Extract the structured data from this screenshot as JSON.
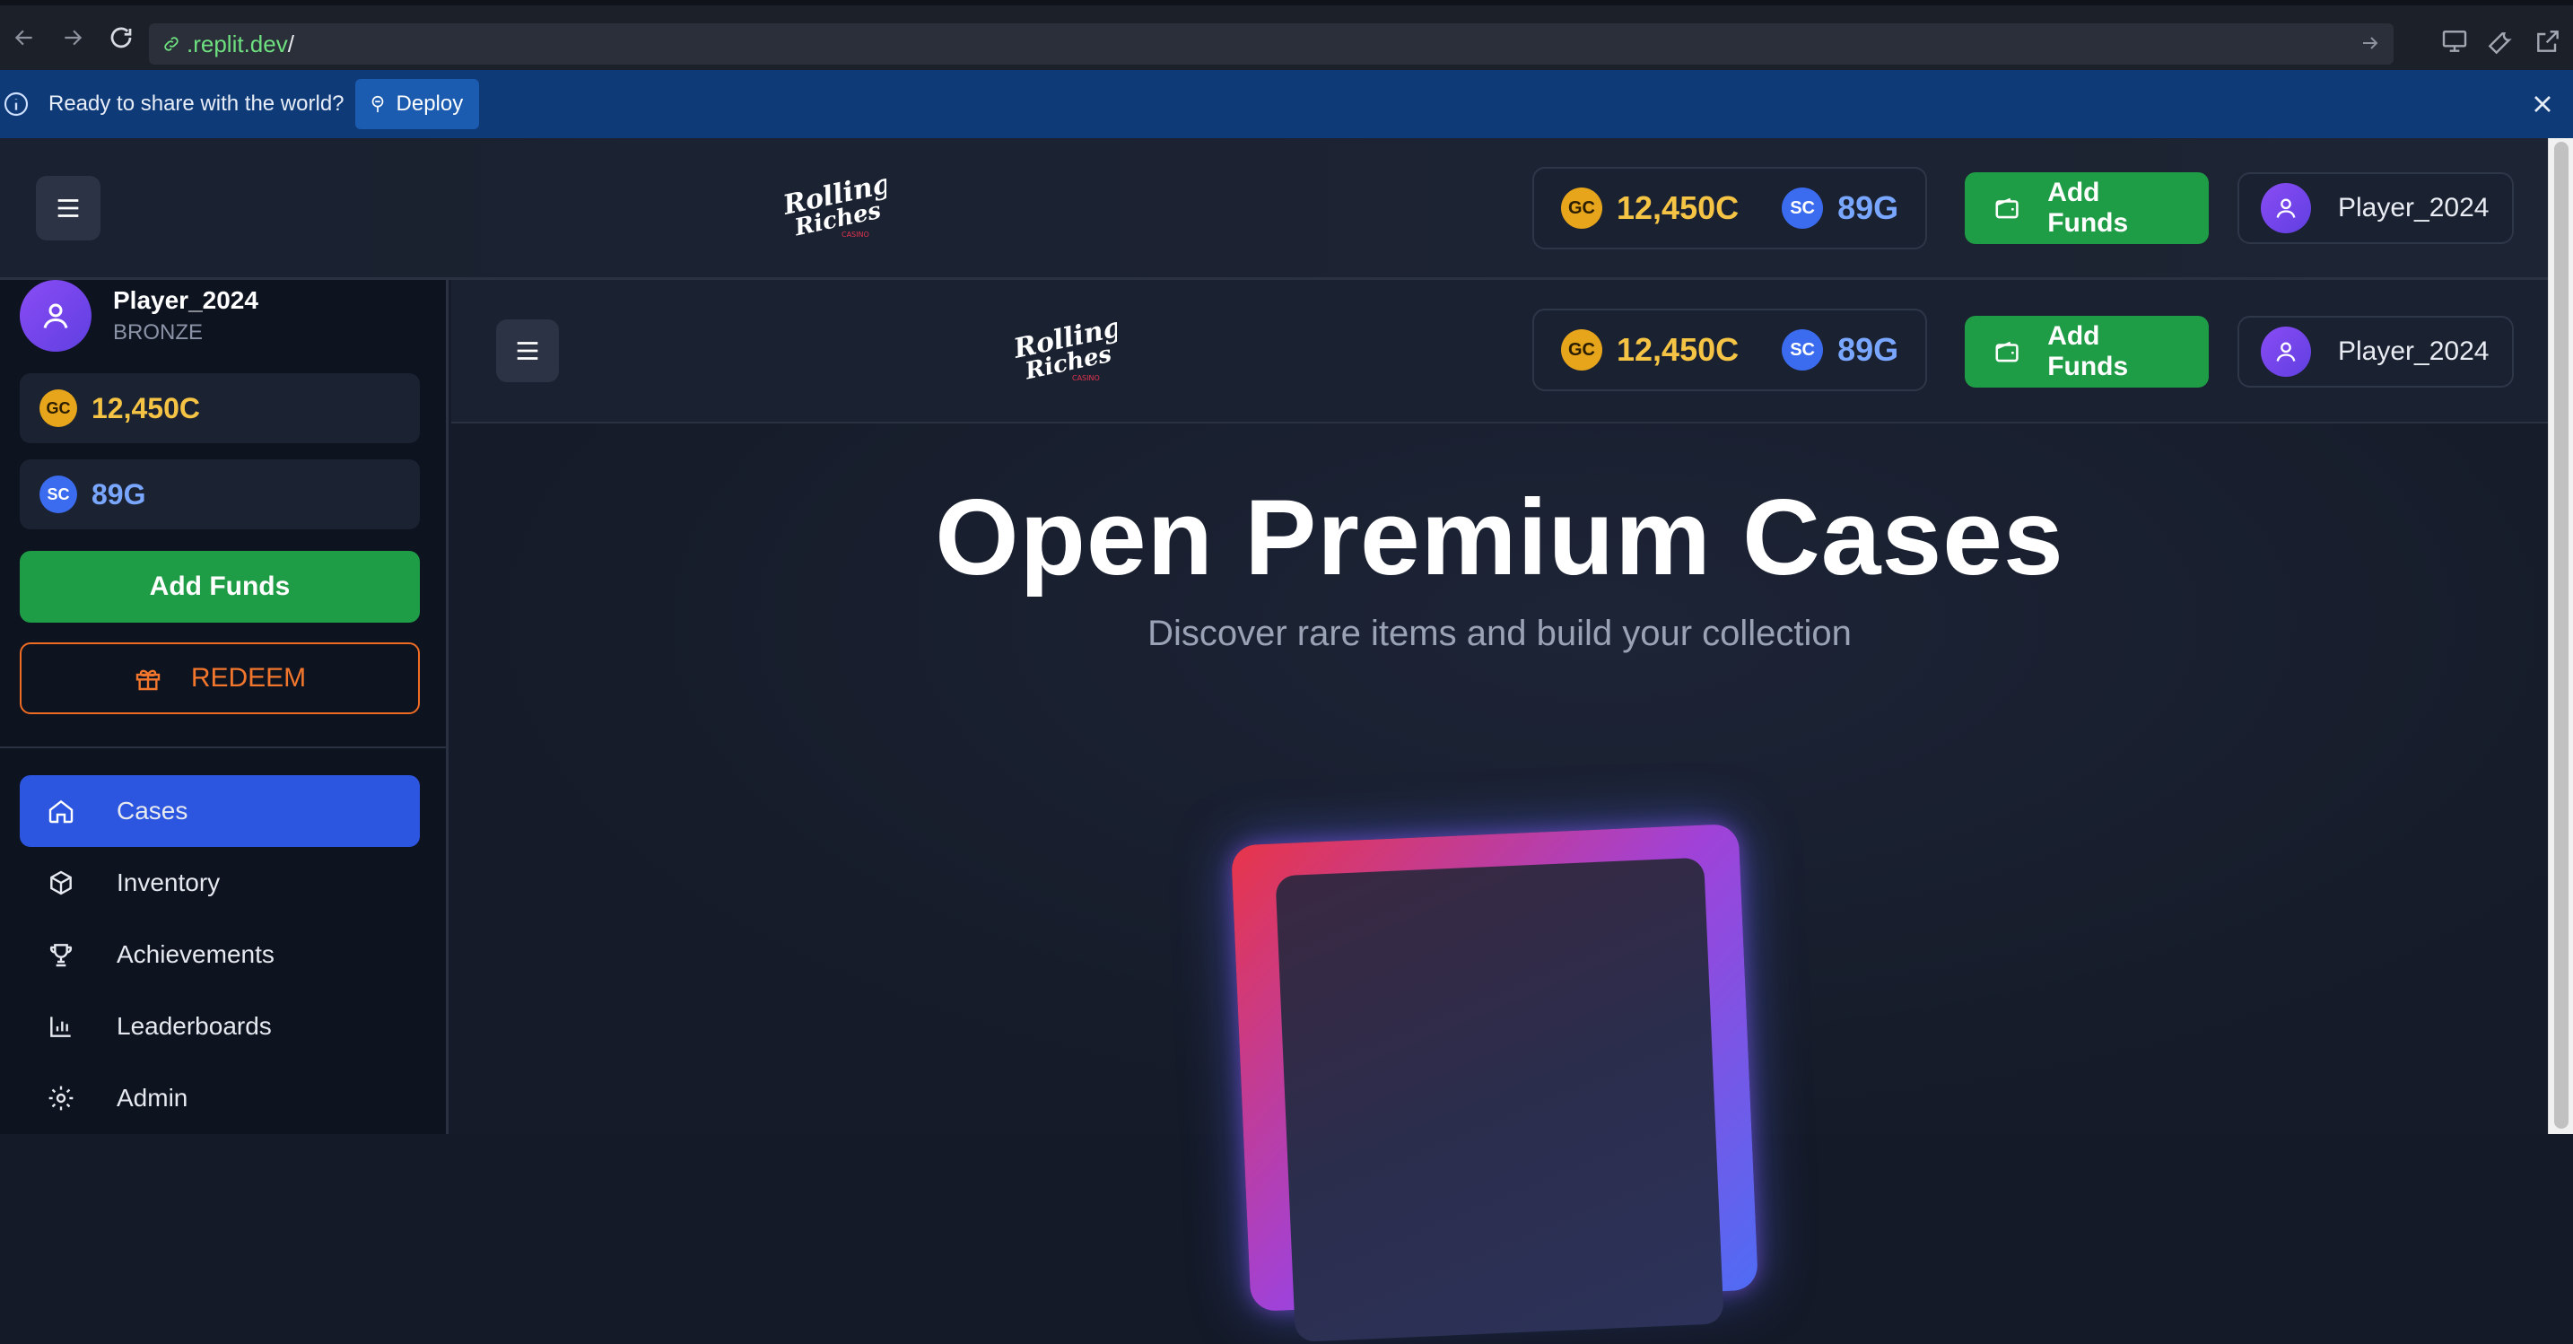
{
  "browser": {
    "url_domain": ".replit.dev",
    "url_path": "/"
  },
  "banner": {
    "message": "Ready to share with the world?",
    "deploy_label": "Deploy"
  },
  "brand": {
    "logo_text": "Rolling Riches",
    "logo_sub": "CASINO"
  },
  "balances": {
    "gc_badge": "GC",
    "gc_value": "12,450C",
    "sc_badge": "SC",
    "sc_value": "89G"
  },
  "header": {
    "add_funds_label": "Add Funds",
    "username": "Player_2024"
  },
  "sidebar": {
    "username": "Player_2024",
    "tier": "BRONZE",
    "add_funds_label": "Add Funds",
    "redeem_label": "REDEEM",
    "nav": [
      {
        "label": "Cases",
        "icon": "home-icon",
        "active": true
      },
      {
        "label": "Inventory",
        "icon": "box-icon",
        "active": false
      },
      {
        "label": "Achievements",
        "icon": "trophy-icon",
        "active": false
      },
      {
        "label": "Leaderboards",
        "icon": "bar-chart-icon",
        "active": false
      },
      {
        "label": "Admin",
        "icon": "gear-icon",
        "active": false
      }
    ]
  },
  "hero": {
    "title": "Open Premium Cases",
    "subtitle": "Discover rare items and build your collection"
  },
  "colors": {
    "accent_blue": "#2d56e0",
    "add_funds_green": "#1f9c46",
    "redeem_orange": "#ef6c24",
    "gold": "#f6c445",
    "sc_blue": "#79a7ff"
  }
}
